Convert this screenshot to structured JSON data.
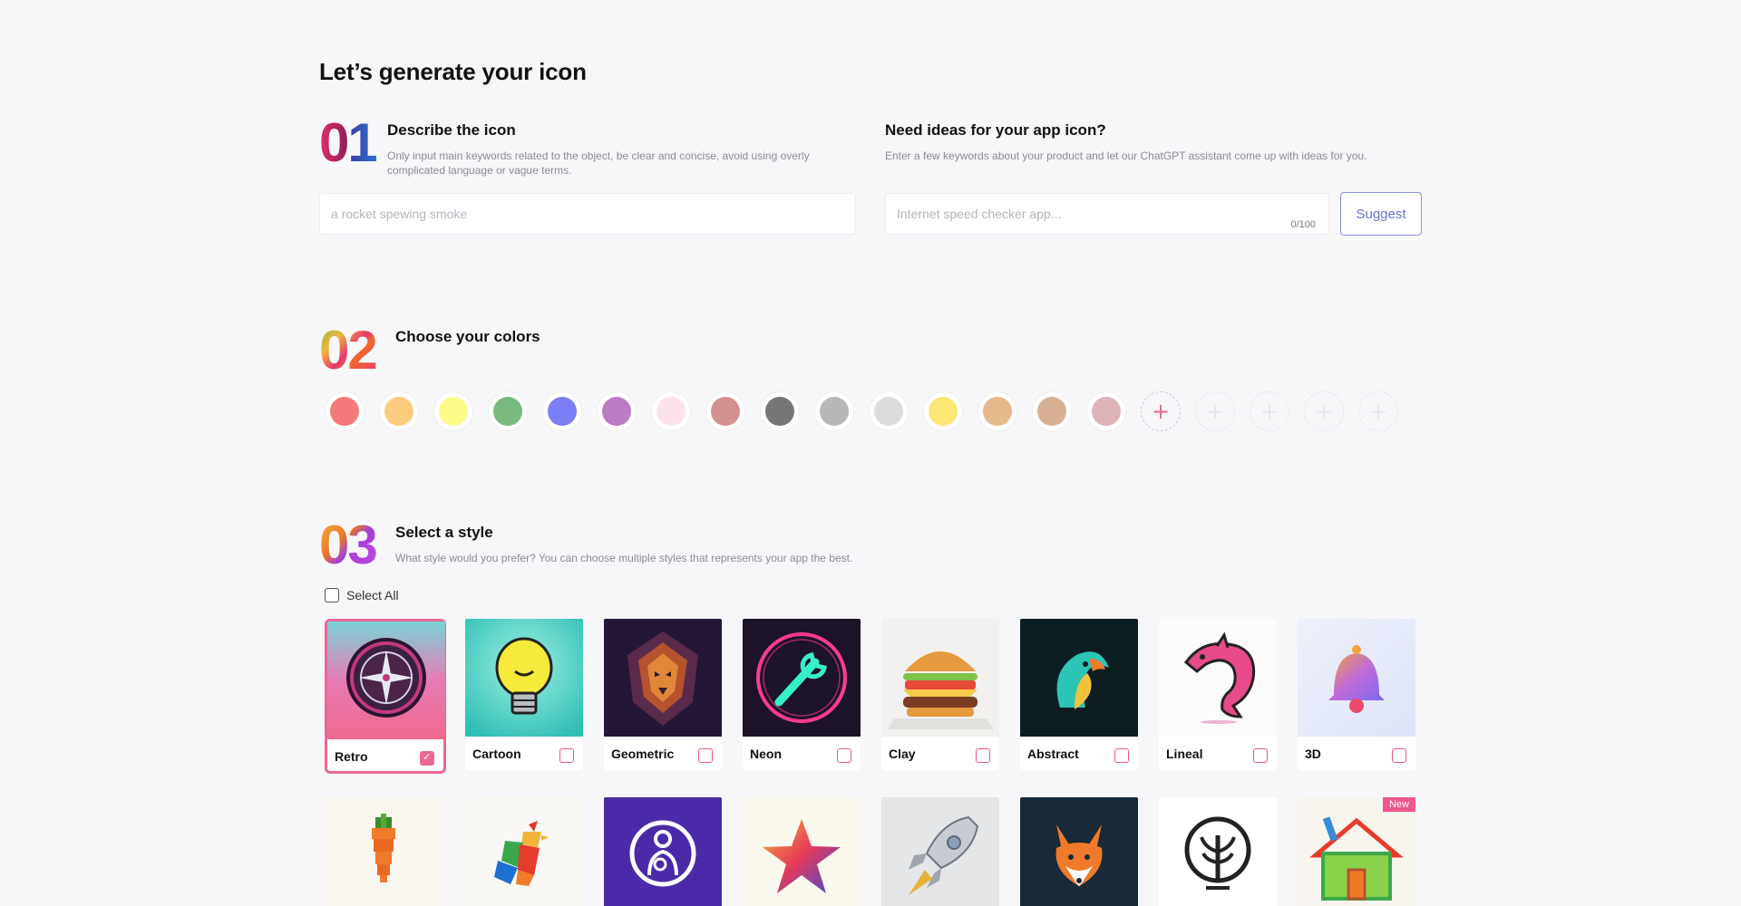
{
  "header": {
    "title": "Let’s generate your icon"
  },
  "step1": {
    "number": "01",
    "title": "Describe the icon",
    "description_line1": "Only input main keywords related to the object, be clear and concise, avoid using overly",
    "description_line2": "complicated language or vague terms.",
    "input_placeholder": "a rocket spewing smoke"
  },
  "ideas": {
    "title": "Need ideas for your app icon?",
    "description": "Enter a few keywords about your product and let our ChatGPT assistant come up with ideas for you.",
    "input_placeholder": "Internet speed checker app...",
    "counter": "0/100",
    "suggest_label": "Suggest"
  },
  "step2": {
    "number": "02",
    "title": "Choose your colors",
    "colors": [
      "#f47a7a",
      "#fbcb7e",
      "#fdfb8a",
      "#78b97d",
      "#7b7ef5",
      "#bb7cc3",
      "#fde2ea",
      "#d49090",
      "#767676",
      "#b8b8b8",
      "#dcdcdc",
      "#fbe676",
      "#e6b98a",
      "#d8b094",
      "#dcb4ba"
    ],
    "add_icon": "plus-icon",
    "empty_slots": 5
  },
  "step3": {
    "number": "03",
    "title": "Select a style",
    "description": "What style would you prefer? You can choose multiple styles that represents your app the best.",
    "select_all_label": "Select All",
    "styles": [
      {
        "label": "Retro",
        "selected": true
      },
      {
        "label": "Cartoon",
        "selected": false
      },
      {
        "label": "Geometric",
        "selected": false
      },
      {
        "label": "Neon",
        "selected": false
      },
      {
        "label": "Clay",
        "selected": false
      },
      {
        "label": "Abstract",
        "selected": false
      },
      {
        "label": "Lineal",
        "selected": false
      },
      {
        "label": "3D",
        "selected": false
      }
    ],
    "row2_badge": "New"
  }
}
